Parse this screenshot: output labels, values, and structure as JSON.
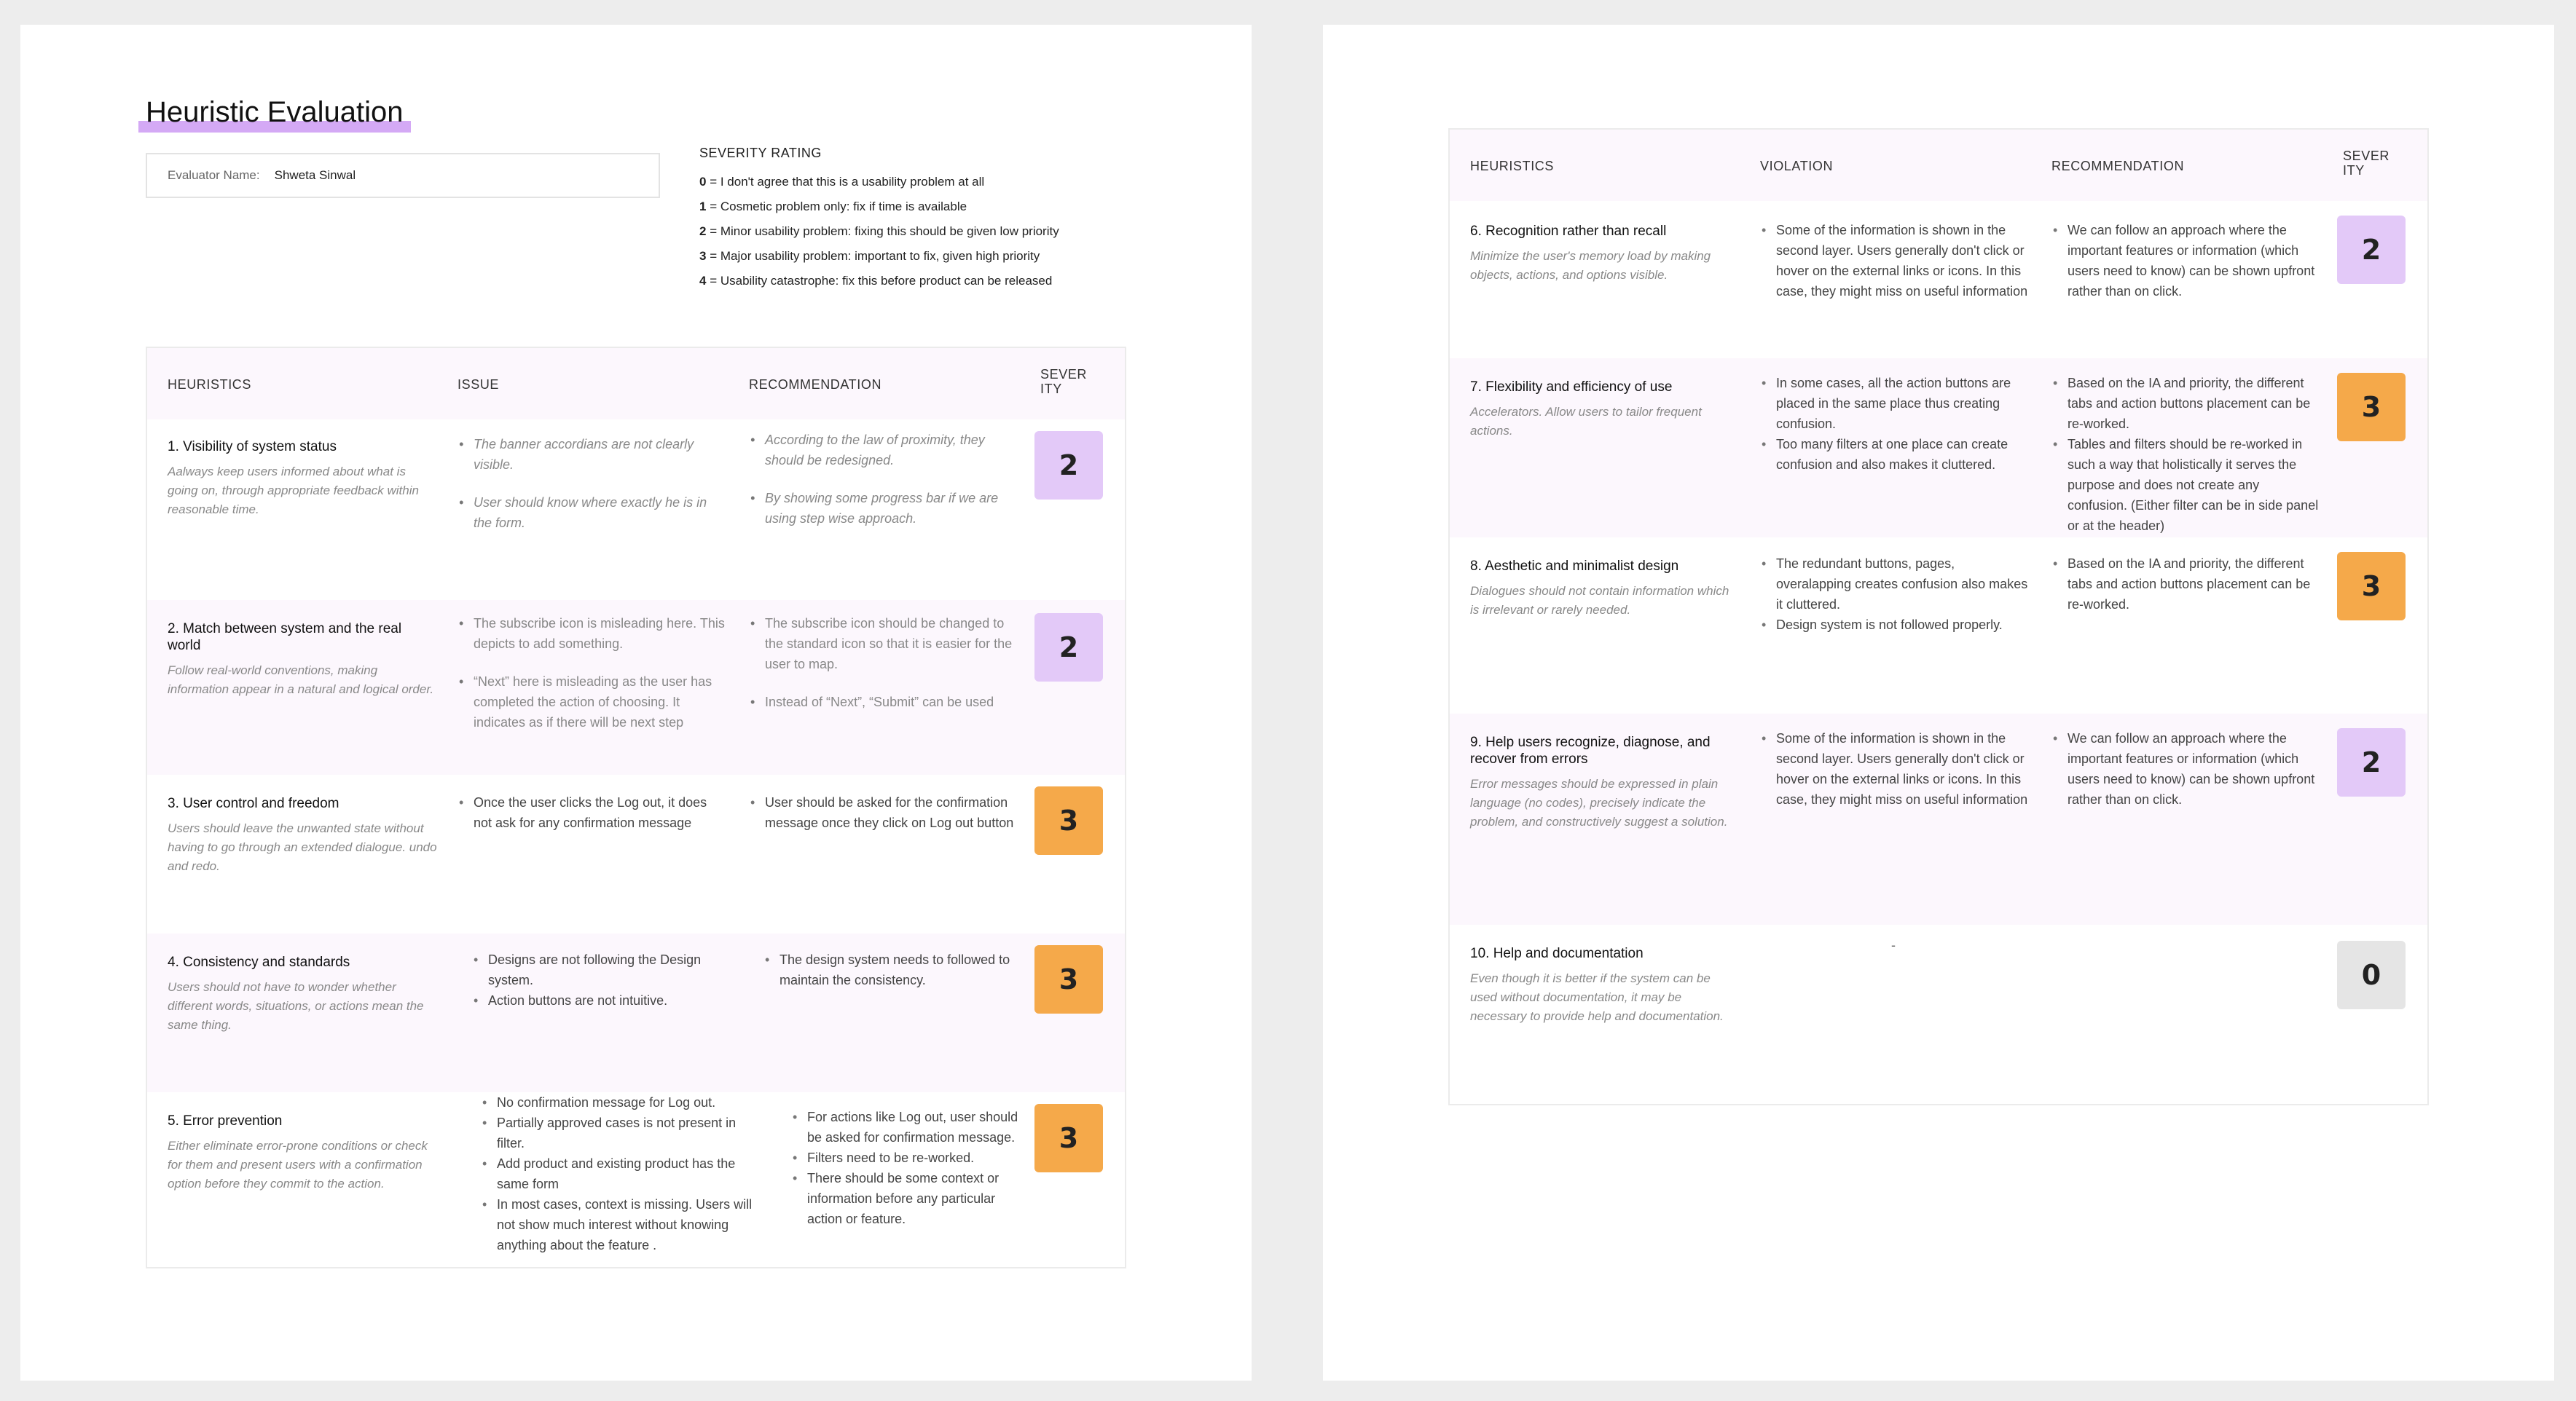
{
  "doc": {
    "title": "Heuristic Evaluation",
    "evaluator_label": "Evaluator Name:",
    "evaluator_name": "Shweta Sinwal"
  },
  "severity_legend": {
    "title": "SEVERITY RATING",
    "items": [
      {
        "score": "0",
        "text": " = I don't agree that this is a usability problem at all"
      },
      {
        "score": "1",
        "text": " = Cosmetic problem only: fix if time is available"
      },
      {
        "score": "2",
        "text": " = Minor usability problem: fixing this should be given low priority"
      },
      {
        "score": "3",
        "text": " = Major usability problem: important to fix, given high priority"
      },
      {
        "score": "4",
        "text": " = Usability catastrophe: fix this before product can be released"
      }
    ]
  },
  "left_table": {
    "headers": [
      "HEURISTICS",
      "ISSUE",
      "RECOMMENDATION",
      "SEVER",
      "ITY"
    ],
    "rows": [
      {
        "title": "1. Visibility of system status",
        "desc": "Aalways keep users informed about what is going on, through appropriate feedback within reasonable time.",
        "issues": [
          "The banner accordians are not clearly visible.",
          "User should know where exactly he is in the form."
        ],
        "recs": [
          "According to the law of proximity, they should be redesigned.",
          "By showing some progress bar if we are using step wise approach."
        ],
        "severity": "2"
      },
      {
        "title": "2. Match between system and the real world",
        "desc": "Follow real-world conventions, making information appear in a natural and logical order.",
        "issues": [
          "The subscribe icon is misleading here. This depicts to add something.",
          "“Next” here is misleading as the user has completed the action of choosing. It indicates as if there will be next step"
        ],
        "recs": [
          "The subscribe icon should be changed to the standard icon so that it is easier for the user to map.",
          "Instead of “Next”, “Submit” can be used"
        ],
        "severity": "2"
      },
      {
        "title": "3. User control and freedom",
        "desc": "Users should leave the unwanted state without having to go through an extended dialogue. undo and redo.",
        "issues": [
          "Once the user clicks the Log out, it does not ask for any confirmation message"
        ],
        "recs": [
          "User should be asked for the confirmation message once they click on Log out button"
        ],
        "severity": "3"
      },
      {
        "title": "4. Consistency and standards",
        "desc": "Users should not have to wonder whether different words, situations, or actions mean the same thing.",
        "issues": [
          "Designs are not following the Design system.",
          "Action buttons are not intuitive."
        ],
        "recs": [
          "The design system needs to followed to maintain the consistency."
        ],
        "severity": "3"
      },
      {
        "title": "5. Error prevention",
        "desc": "Either eliminate error-prone conditions or check for them and present users with a confirmation option before they commit to the action.",
        "issues": [
          "No confirmation message for Log out.",
          "Partially approved cases is not present in filter.",
          "Add product and existing product has the same form",
          "In most cases, context is missing. Users will not show much interest without knowing anything about the feature ."
        ],
        "recs": [
          "For actions like Log out, user should be asked for confirmation message.",
          "Filters need to be re-worked.",
          "There should be some context or information before any particular action or feature."
        ],
        "severity": "3"
      }
    ]
  },
  "right_table": {
    "headers": [
      "HEURISTICS",
      "VIOLATION",
      "RECOMMENDATION",
      "SEVER",
      "ITY"
    ],
    "rows": [
      {
        "title": "6. Recognition rather than recall",
        "desc": "Minimize the user's memory load by making objects, actions, and options visible.",
        "issues": [
          "Some of the information is shown in the second layer. Users generally don't click or hover on the external links or icons. In this case, they might miss on useful information"
        ],
        "recs": [
          "We can follow an approach where the important features or information (which users need to know) can be shown upfront rather than on click."
        ],
        "severity": "2"
      },
      {
        "title": "7. Flexibility and efficiency of use",
        "desc": "Accelerators. Allow users to tailor frequent actions.",
        "issues": [
          "In some cases, all the action buttons are placed in the same place thus creating confusion.",
          "Too many filters at one place can create confusion and also makes it cluttered."
        ],
        "recs": [
          "Based on the IA and priority, the different tabs and action buttons placement can be re-worked.",
          "Tables and filters should be re-worked in such a way that holistically it serves the purpose and does not create any confusion. (Either filter can be in side panel or at the header)"
        ],
        "severity": "3"
      },
      {
        "title": "8. Aesthetic and minimalist design",
        "desc": "Dialogues should not contain information which is irrelevant or rarely needed.",
        "issues": [
          "The redundant buttons, pages, overalapping creates confusion also makes it cluttered.",
          "Design system is not followed properly."
        ],
        "recs": [
          "Based on the IA and priority, the different tabs and action buttons placement can be re-worked."
        ],
        "severity": "3"
      },
      {
        "title": "9. Help users recognize, diagnose, and recover from errors",
        "desc": "Error messages should be expressed in plain language (no codes), precisely indicate the problem, and constructively suggest a solution.",
        "issues": [
          "Some of the information is shown in the second layer. Users generally don't click or hover on the external links or icons. In this case, they might miss on useful information"
        ],
        "recs": [
          "We can follow an approach where the important features or information (which users need to know) can be shown upfront rather than on click."
        ],
        "severity": "2"
      },
      {
        "title": "10. Help and documentation",
        "desc": "Even though it is better if the system can be used without documentation, it may be necessary to provide help and documentation.",
        "issues": [],
        "recs": [],
        "dash": "-",
        "severity": "0"
      }
    ]
  },
  "colors": {
    "severity_2": "#e3c9f8",
    "severity_3": "#f5a94a",
    "severity_0": "#e5e5e5",
    "row_alt": "#fcf7fd",
    "title_highlight": "#d4a9f5"
  }
}
